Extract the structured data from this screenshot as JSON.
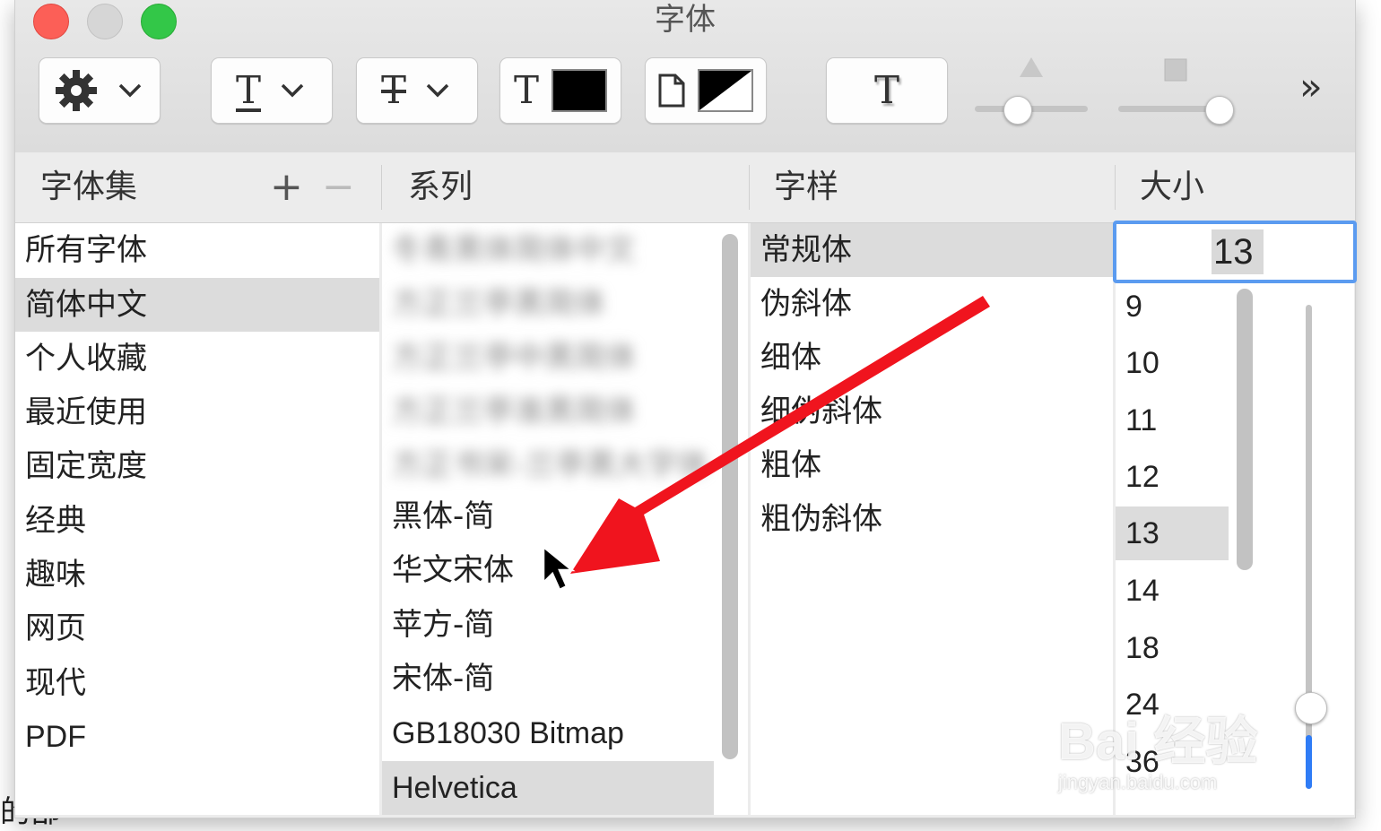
{
  "window": {
    "title": "字体"
  },
  "outside_text": "的部",
  "columns": {
    "collections": {
      "header": "字体集",
      "add_label": "+",
      "remove_label": "−",
      "items": [
        "所有字体",
        "简体中文",
        "个人收藏",
        "最近使用",
        "固定宽度",
        "经典",
        "趣味",
        "网页",
        "现代",
        "PDF"
      ],
      "selected": "简体中文"
    },
    "family": {
      "header": "系列",
      "blurred_items": [
        "冬青黑体简体中文",
        "方正兰亭黑简体",
        "方正兰亭中黑简体",
        "方正兰亭准黑简体",
        "方正书宋-兰亭黑大字体"
      ],
      "items": [
        "黑体-简",
        "华文宋体",
        "苹方-简",
        "宋体-简",
        "GB18030 Bitmap",
        "Helvetica"
      ],
      "selected": "Helvetica"
    },
    "typeface": {
      "header": "字样",
      "items": [
        "常规体",
        "伪斜体",
        "细体",
        "细伪斜体",
        "粗体",
        "粗伪斜体"
      ],
      "selected": "常规体"
    },
    "size": {
      "header": "大小",
      "current": "13",
      "items": [
        "9",
        "10",
        "11",
        "12",
        "13",
        "14",
        "18",
        "24",
        "36"
      ],
      "selected": "13"
    }
  },
  "toolbar": {
    "action_icon": "gear-icon",
    "underline_glyph": "T",
    "strikethrough_glyph": "T",
    "text_color_glyph": "T",
    "text_color": "#000000",
    "doc_color_icon": "document-icon",
    "shadow_glyph": "T",
    "more_label": "»"
  },
  "watermark": {
    "main": "Bai 经验",
    "sub": "jingyan.baidu.com"
  },
  "colors": {
    "accent": "#2f7cf6",
    "annotation_arrow": "#f0141e"
  }
}
